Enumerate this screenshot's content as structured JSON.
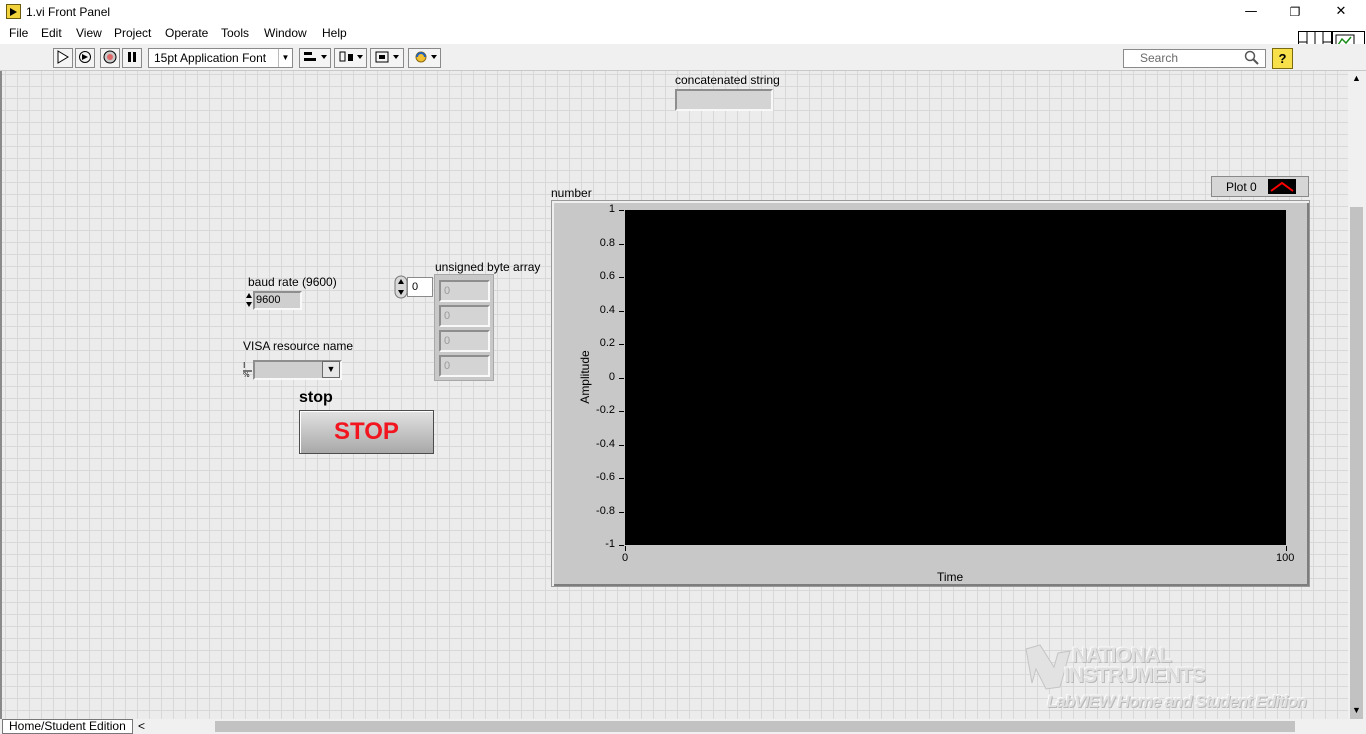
{
  "window": {
    "title": "1.vi Front Panel",
    "minimize": "—",
    "maximize": "❐",
    "close": "✕"
  },
  "menu": [
    "File",
    "Edit",
    "View",
    "Project",
    "Operate",
    "Tools",
    "Window",
    "Help"
  ],
  "toolbar": {
    "font": "15pt Application Font",
    "search_placeholder": "Search",
    "help": "?"
  },
  "controls": {
    "concatenated_string": {
      "label": "concatenated string",
      "value": ""
    },
    "baud_rate": {
      "label": "baud rate (9600)",
      "value": "9600"
    },
    "visa": {
      "label": "VISA resource name",
      "value": ""
    },
    "array": {
      "label": "unsigned byte array",
      "index": "0",
      "elements": [
        "0",
        "0",
        "0",
        "0"
      ]
    },
    "stop": {
      "label": "stop",
      "text": "STOP"
    }
  },
  "chart_data": {
    "type": "line",
    "title": "number",
    "xlabel": "Time",
    "ylabel": "Amplitude",
    "xlim": [
      0,
      100
    ],
    "ylim": [
      -1,
      1
    ],
    "x_ticks": [
      "0",
      "100"
    ],
    "y_ticks": [
      "1",
      "0.8",
      "0.6",
      "0.4",
      "0.2",
      "0",
      "-0.2",
      "-0.4",
      "-0.6",
      "-0.8",
      "-1"
    ],
    "series": [
      {
        "name": "Plot 0",
        "values": [],
        "color": "#ff0000"
      }
    ],
    "plot_background": "#000000",
    "legend_position": "top-right"
  },
  "statusbar": {
    "tab": "Home/Student Edition",
    "scroll_left": "<"
  },
  "watermark": {
    "line1": "NATIONAL",
    "line2": "INSTRUMENTS",
    "line3": "LabVIEW Home and Student Edition"
  }
}
